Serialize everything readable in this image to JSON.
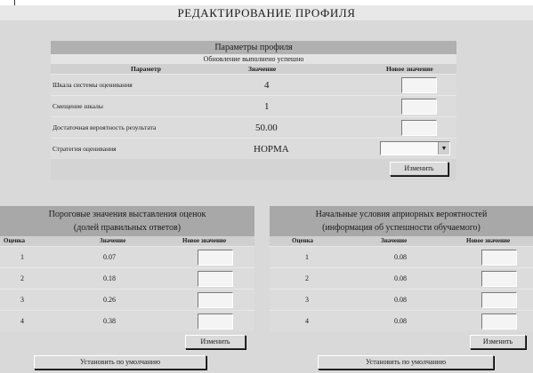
{
  "page_title": "РЕДАКТИРОВАНИЕ ПРОФИЛЯ",
  "profile": {
    "header": "Параметры профиля",
    "status": "Обновление выполнено успешно",
    "columns": {
      "param": "Параметр",
      "value": "Значение",
      "new_value": "Новое значение"
    },
    "rows": [
      {
        "name": "Шкала системы оценивания",
        "value": "4"
      },
      {
        "name": "Смещение шкалы",
        "value": "1"
      },
      {
        "name": "Достаточная вероятность результата",
        "value": "50.00"
      },
      {
        "name": "Стратегия оценивания",
        "value": "НОРМА"
      }
    ],
    "select_arrow": "▼",
    "submit_label": "Изменить"
  },
  "thresholds": {
    "header_line1": "Пороговые значения выставления оценок",
    "header_line2": "(долей правильных ответов)",
    "columns": {
      "grade": "Оценка",
      "value": "Значение",
      "new_value": "Новое значение"
    },
    "rows": [
      {
        "grade": "1",
        "value": "0.07"
      },
      {
        "grade": "2",
        "value": "0.18"
      },
      {
        "grade": "3",
        "value": "0.26"
      },
      {
        "grade": "4",
        "value": "0.38"
      }
    ],
    "submit_label": "Изменить",
    "default_label": "Установить по умолчанию"
  },
  "priors": {
    "header_line1": "Начальные условия априорных вероятностей",
    "header_line2": "(информация об успешности обучаемого)",
    "columns": {
      "grade": "Оценка",
      "value": "Значение",
      "new_value": "Новое значение"
    },
    "rows": [
      {
        "grade": "1",
        "value": "0.08"
      },
      {
        "grade": "2",
        "value": "0.08"
      },
      {
        "grade": "3",
        "value": "0.08"
      },
      {
        "grade": "4",
        "value": "0.08"
      }
    ],
    "submit_label": "Изменить",
    "default_label": "Установить по умолчанию"
  }
}
